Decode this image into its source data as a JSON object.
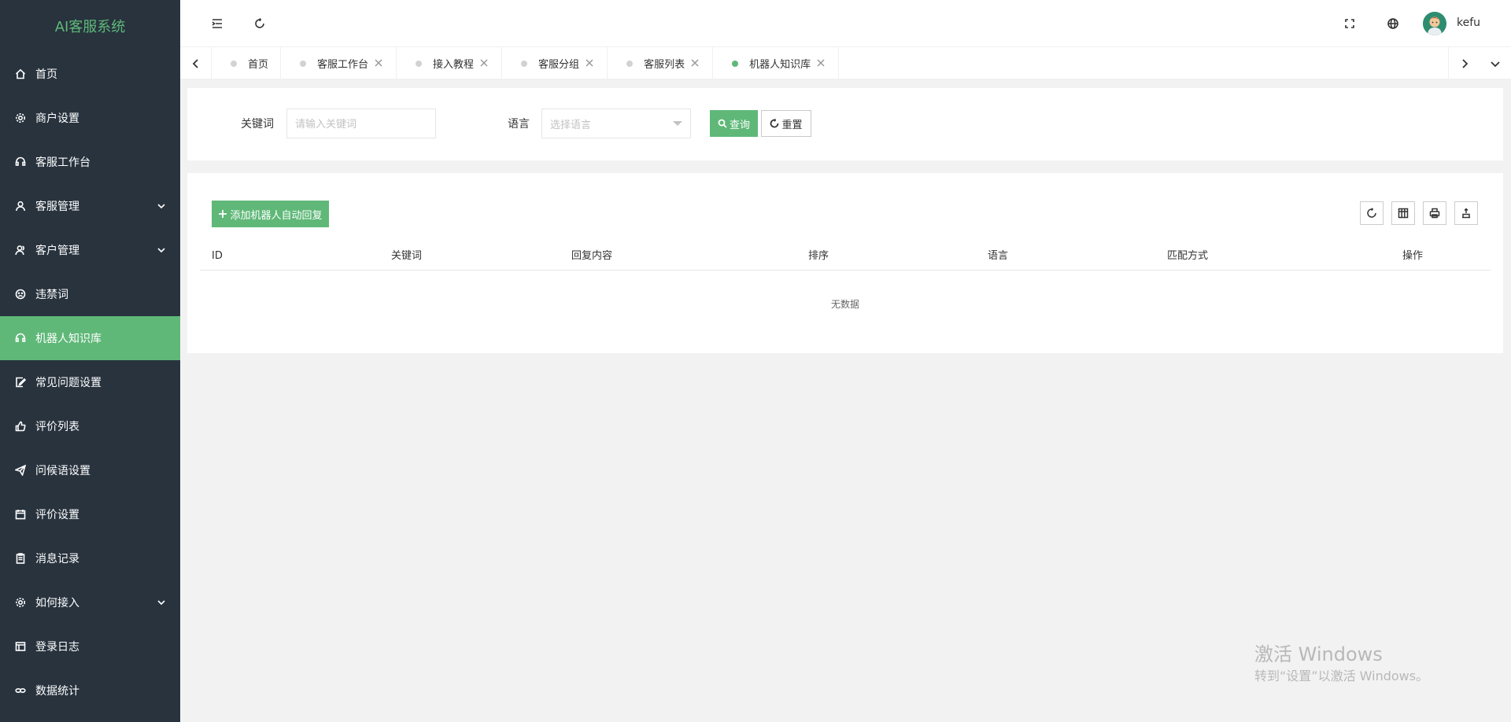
{
  "app": {
    "logo": "AI客服系统"
  },
  "sidebar": {
    "items": [
      {
        "label": "首页",
        "icon": "home-icon"
      },
      {
        "label": "商户设置",
        "icon": "gear-icon"
      },
      {
        "label": "客服工作台",
        "icon": "headset-icon"
      },
      {
        "label": "客服管理",
        "icon": "user-icon",
        "expandable": true
      },
      {
        "label": "客户管理",
        "icon": "users-icon",
        "expandable": true
      },
      {
        "label": "违禁词",
        "icon": "face-icon"
      },
      {
        "label": "机器人知识库",
        "icon": "headset-icon",
        "active": true
      },
      {
        "label": "常见问题设置",
        "icon": "edit-icon"
      },
      {
        "label": "评价列表",
        "icon": "thumb-icon"
      },
      {
        "label": "问候语设置",
        "icon": "send-icon"
      },
      {
        "label": "评价设置",
        "icon": "calendar-icon"
      },
      {
        "label": "消息记录",
        "icon": "clipboard-icon"
      },
      {
        "label": "如何接入",
        "icon": "gear-icon",
        "expandable": true
      },
      {
        "label": "登录日志",
        "icon": "table-icon"
      },
      {
        "label": "数据统计",
        "icon": "link-icon"
      }
    ]
  },
  "header": {
    "username": "kefu"
  },
  "tabs": [
    {
      "label": "首页",
      "closable": false
    },
    {
      "label": "客服工作台",
      "closable": true
    },
    {
      "label": "接入教程",
      "closable": true
    },
    {
      "label": "客服分组",
      "closable": true
    },
    {
      "label": "客服列表",
      "closable": true
    },
    {
      "label": "机器人知识库",
      "closable": true,
      "active": true
    }
  ],
  "search": {
    "keyword_label": "关键词",
    "keyword_placeholder": "请输入关键词",
    "language_label": "语言",
    "language_placeholder": "选择语言",
    "query_button": "查询",
    "reset_button": "重置"
  },
  "table": {
    "add_button": "添加机器人自动回复",
    "columns": [
      "ID",
      "关键词",
      "回复内容",
      "排序",
      "语言",
      "匹配方式",
      "操作"
    ],
    "empty_text": "无数据"
  },
  "watermark": {
    "line1": "激活 Windows",
    "line2": "转到“设置”以激活 Windows。"
  },
  "colors": {
    "accent": "#5fb878",
    "sidebar": "#28333e",
    "background": "#f2f2f2"
  }
}
